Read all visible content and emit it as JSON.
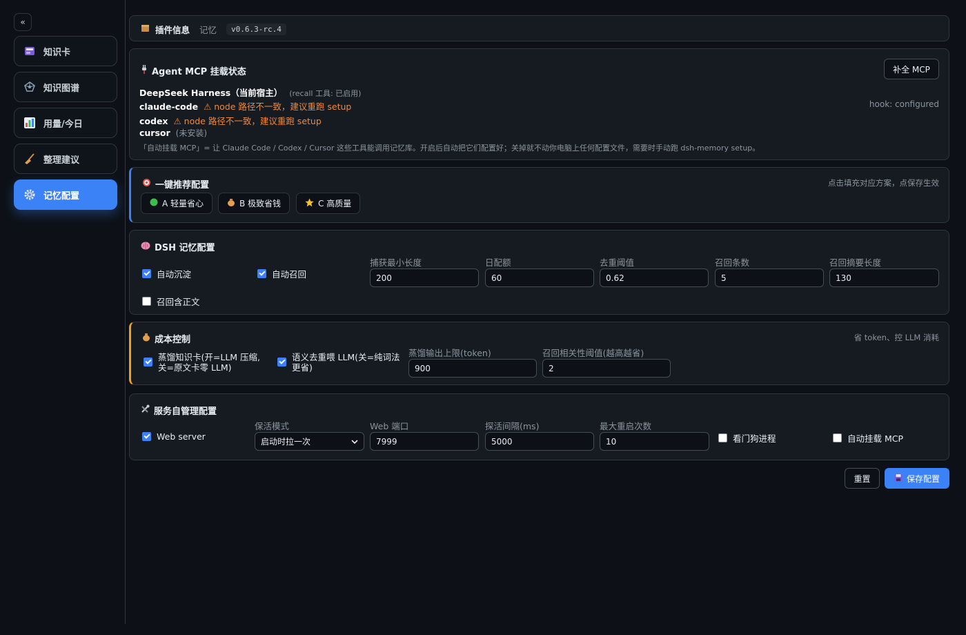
{
  "sidebar": {
    "collapse_label": "«",
    "items": [
      {
        "label": "知识卡",
        "icon": "card-box-icon"
      },
      {
        "label": "知识图谱",
        "icon": "network-icon"
      },
      {
        "label": "用量/今日",
        "icon": "bar-chart-icon"
      },
      {
        "label": "整理建议",
        "icon": "broom-icon"
      },
      {
        "label": "记忆配置",
        "icon": "gear-icon",
        "active": true
      }
    ]
  },
  "plugin_info": {
    "title": "插件信息",
    "name": "记忆",
    "version": "v0.6.3-rc.4"
  },
  "mcp": {
    "title": "Agent MCP 挂载状态",
    "fill_button": "补全 MCP",
    "deepseek_name": "DeepSeek Harness（当前宿主）",
    "deepseek_note": "(recall 工具: 已启用)",
    "claude_name": "claude-code",
    "claude_warn": "⚠ node 路径不一致，建议重跑 setup",
    "claude_hook": "hook: configured",
    "codex_name": "codex",
    "codex_warn": "⚠ node 路径不一致，建议重跑 setup",
    "cursor_name": "cursor",
    "cursor_note": "(未安装)",
    "description": "「自动挂载 MCP」= 让 Claude Code / Codex / Cursor 这些工具能调用记忆库。开启后自动把它们配置好；关掉就不动你电脑上任何配置文件，需要时手动跑 dsh-memory setup。"
  },
  "presets": {
    "title": "一键推荐配置",
    "hint": "点击填充对应方案，点保存生效",
    "a_label": "A 轻量省心",
    "b_label": "B 极致省钱",
    "c_label": "C 高质量"
  },
  "dsh": {
    "title": "DSH 记忆配置",
    "auto_deposit": "自动沉淀",
    "auto_recall": "自动召回",
    "recall_body": "召回含正文",
    "min_len_label": "捕获最小长度",
    "min_len": "200",
    "daily_quota_label": "日配额",
    "daily_quota": "60",
    "dedup_label": "去重阈值",
    "dedup": "0.62",
    "recall_count_label": "召回条数",
    "recall_count": "5",
    "summary_len_label": "召回摘要长度",
    "summary_len": "130"
  },
  "cost": {
    "title": "成本控制",
    "hint": "省 token、控 LLM 消耗",
    "distill_label": "蒸馏知识卡(开=LLM 压缩, 关=原文卡零 LLM)",
    "semantic_label": "语义去重喂 LLM(关=纯词法更省)",
    "distill_max_label": "蒸馏输出上限(token)",
    "distill_max": "900",
    "relevance_label": "召回相关性阈值(越高越省)",
    "relevance": "2"
  },
  "service": {
    "title": "服务自管理配置",
    "web_server": "Web server",
    "keepalive_label": "保活模式",
    "keepalive": "启动时拉一次",
    "port_label": "Web 端口",
    "port": "7999",
    "probe_label": "探活间隔(ms)",
    "probe": "5000",
    "restart_label": "最大重启次数",
    "restart": "10",
    "watchdog": "看门狗进程",
    "auto_mount": "自动挂载 MCP"
  },
  "actions": {
    "reset": "重置",
    "save": "保存配置"
  },
  "colors": {
    "accent": "#3b82f6",
    "warning": "#f0883e",
    "amber": "#f0a020"
  }
}
